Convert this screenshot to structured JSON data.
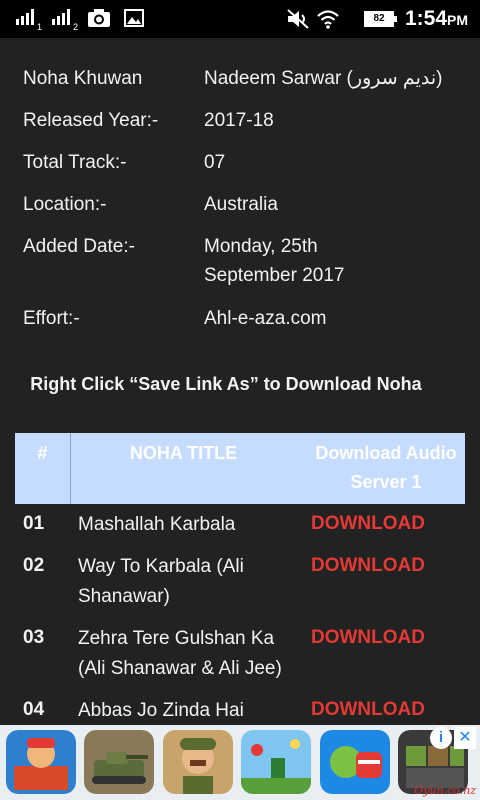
{
  "status_bar": {
    "sim1_label": "1",
    "sim2_label": "2",
    "battery": "82",
    "time": "1:54",
    "ampm": "PM",
    "icons": [
      "signal-icon",
      "signal-icon",
      "camera-icon",
      "image-icon",
      "mute-icon",
      "wifi-icon",
      "battery-icon"
    ]
  },
  "info": {
    "rows": [
      {
        "label": "Noha Khuwan",
        "value": "Nadeem Sarwar (ندیم سرور)"
      },
      {
        "label": "Released Year:-",
        "value": "2017-18"
      },
      {
        "label": "Total Track:-",
        "value": "07"
      },
      {
        "label": "Location:-",
        "value": "Australia"
      },
      {
        "label": "Added Date:-",
        "value": "Monday, 25th September 2017"
      },
      {
        "label": "Effort:-",
        "value": "Ahl-e-aza.com"
      }
    ]
  },
  "notice": "Right Click “Save Link As” to Download Noha",
  "table": {
    "headers": {
      "num": "#",
      "title": "NOHA TITLE",
      "download": "Download Audio Server 1"
    },
    "rows": [
      {
        "num": "01",
        "title": "Mashallah Karbala",
        "link": "DOWNLOAD"
      },
      {
        "num": "02",
        "title": "Way To Karbala (Ali Shanawar)",
        "link": "DOWNLOAD"
      },
      {
        "num": "03",
        "title": "Zehra Tere Gulshan Ka (Ali Shanawar & Ali Jee)",
        "link": "DOWNLOAD"
      },
      {
        "num": "04",
        "title": "Abbas Jo Zinda Hai",
        "link": "DOWNLOAD"
      }
    ]
  },
  "ad": {
    "brand": "Oyun.co.nz",
    "info_icon": "info-icon",
    "close_icon": "close-icon",
    "tiles": [
      "subway-game",
      "tank-game",
      "soldier-game",
      "platform-game",
      "candy-game",
      "block-game"
    ]
  },
  "colors": {
    "background": "#222222",
    "header_bg": "#c6dcff",
    "download_link": "#e53935"
  }
}
